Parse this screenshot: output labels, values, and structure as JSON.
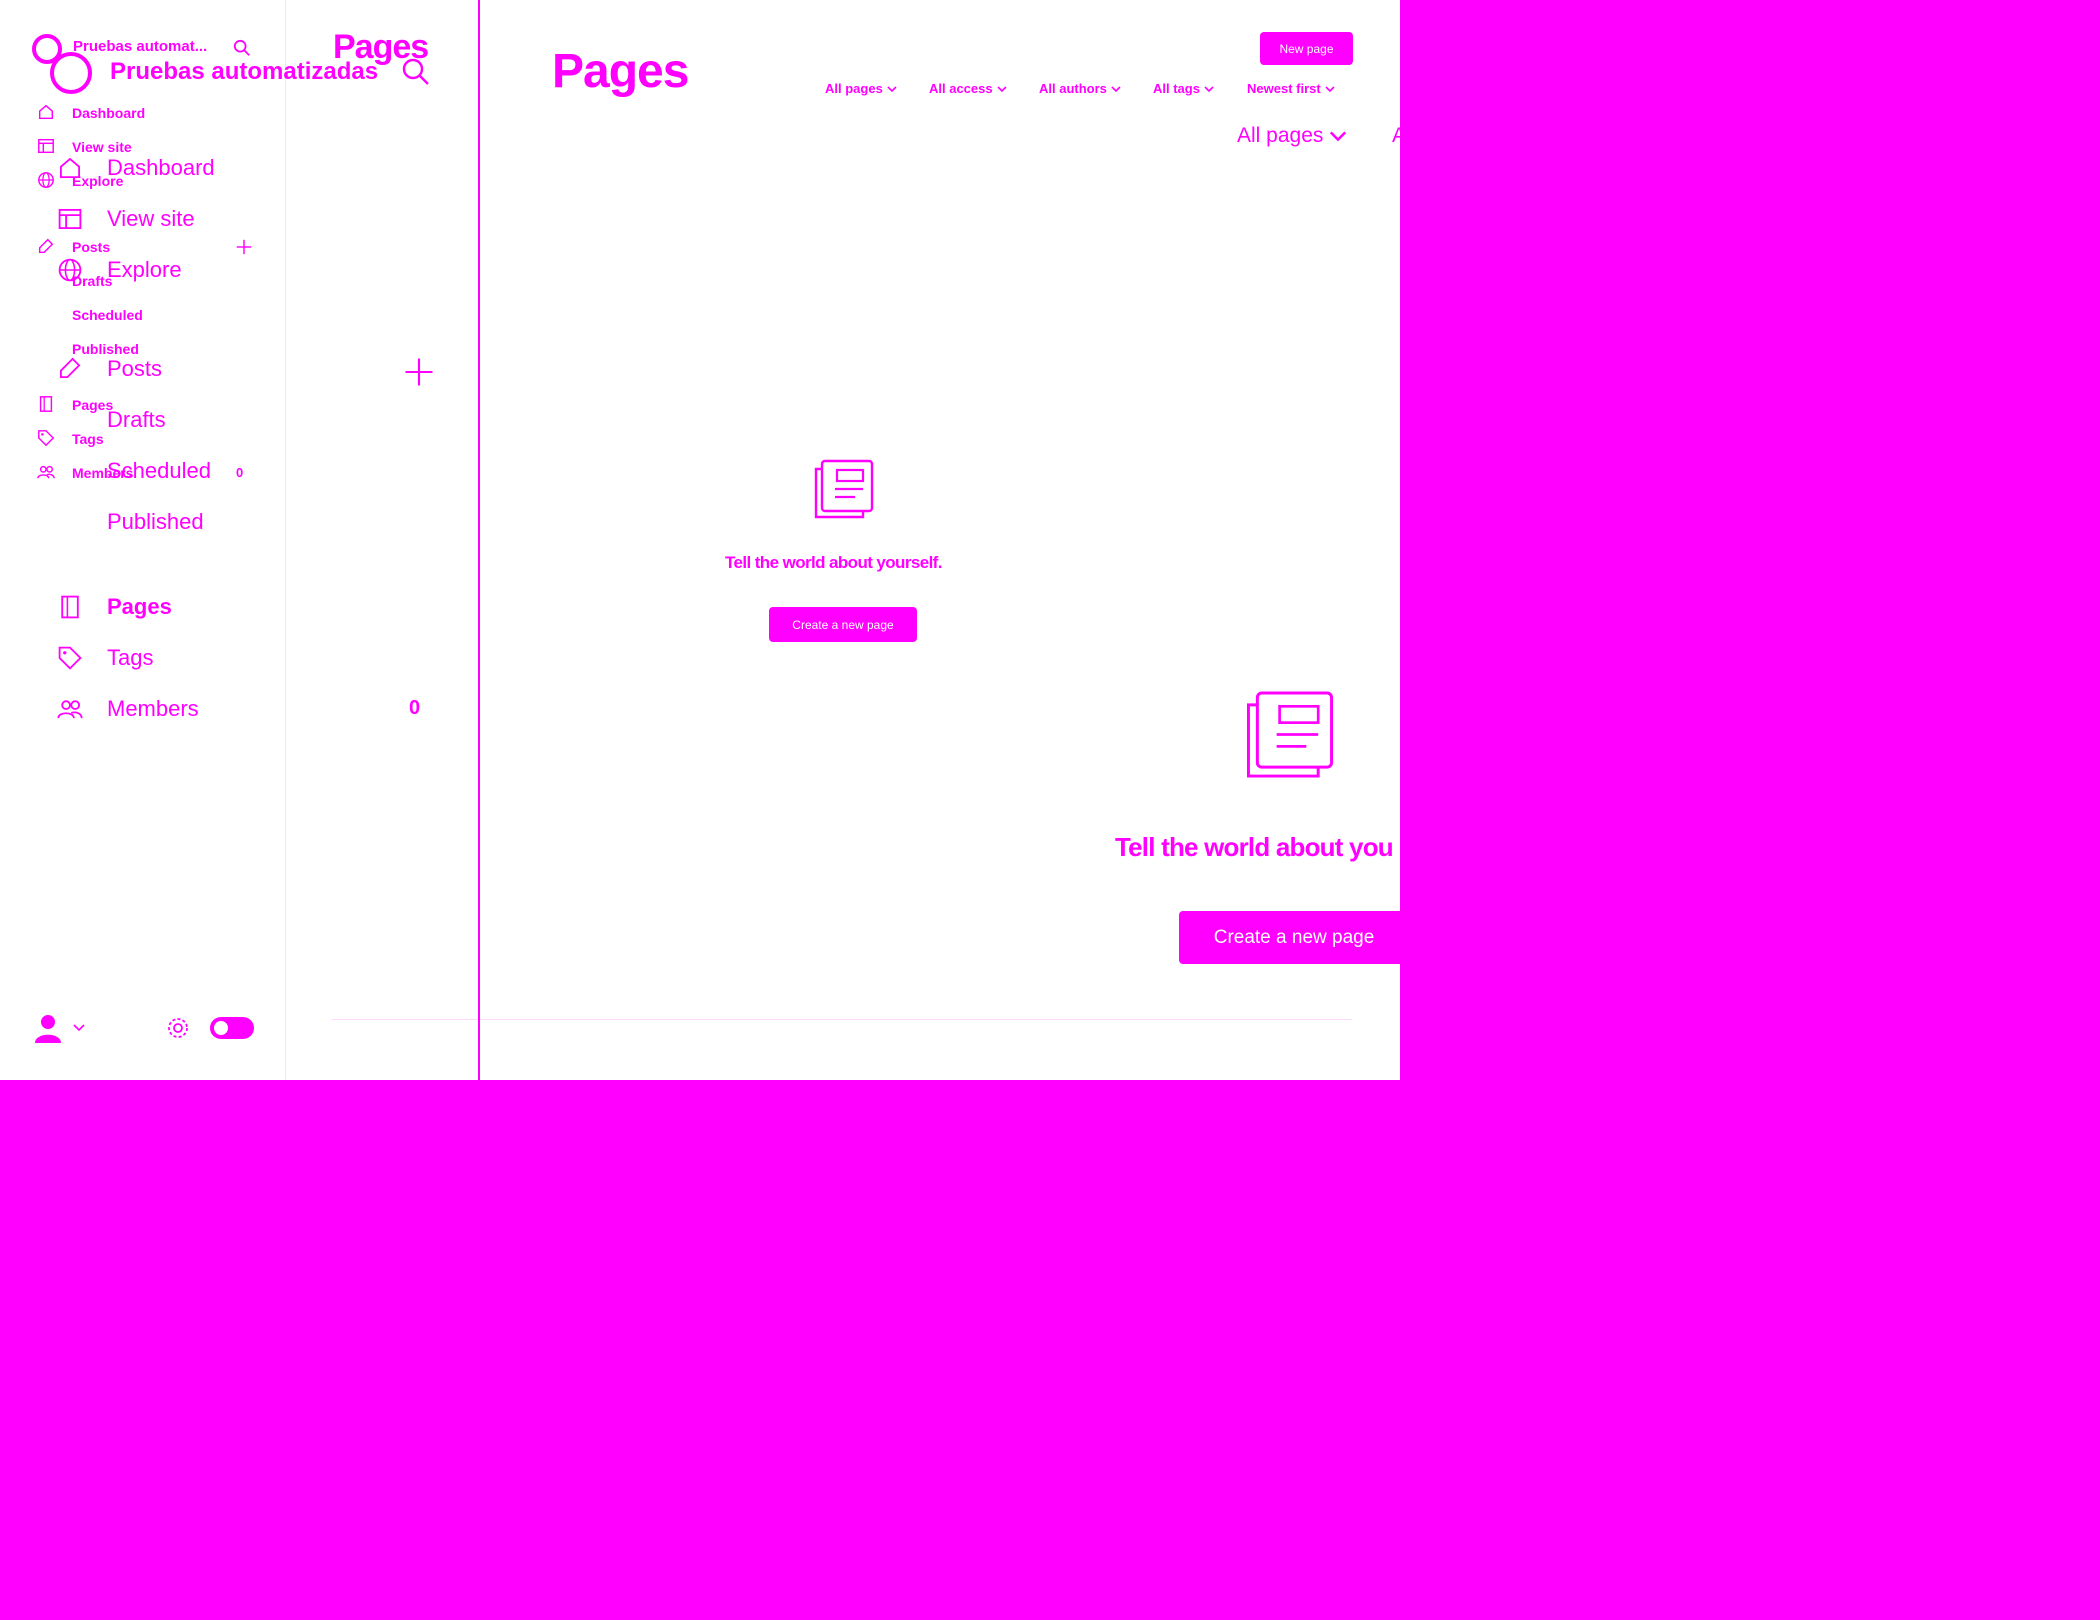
{
  "app": {
    "site_name_short": "Pruebas automat...",
    "site_name_full": "Pruebas automatizadas"
  },
  "nav": {
    "dashboard": "Dashboard",
    "view_site": "View site",
    "explore": "Explore",
    "posts": "Posts",
    "drafts": "Drafts",
    "scheduled": "Scheduled",
    "published": "Published",
    "pages": "Pages",
    "tags": "Tags",
    "members": "Members",
    "members_count": "0"
  },
  "header": {
    "title": "Pages",
    "new_page_button": "New page"
  },
  "filters": [
    "All pages",
    "All access",
    "All authors",
    "All tags",
    "Newest first"
  ],
  "empty_state": {
    "message": "Tell the world about yourself.",
    "message_clipped": "Tell the world about you",
    "button": "Create a new page"
  },
  "ghost_filter_partial": "A",
  "colors": {
    "accent": "#ff00ff",
    "background": "#ffffff"
  },
  "icons": [
    "brand-logo-icon",
    "search-icon",
    "home-icon",
    "view-site-icon",
    "globe-icon",
    "pencil-icon",
    "plus-icon",
    "pages-icon",
    "tag-icon",
    "members-icon",
    "user-icon",
    "chevron-down-icon",
    "gear-icon",
    "toggle-switch",
    "page-document-icon"
  ]
}
